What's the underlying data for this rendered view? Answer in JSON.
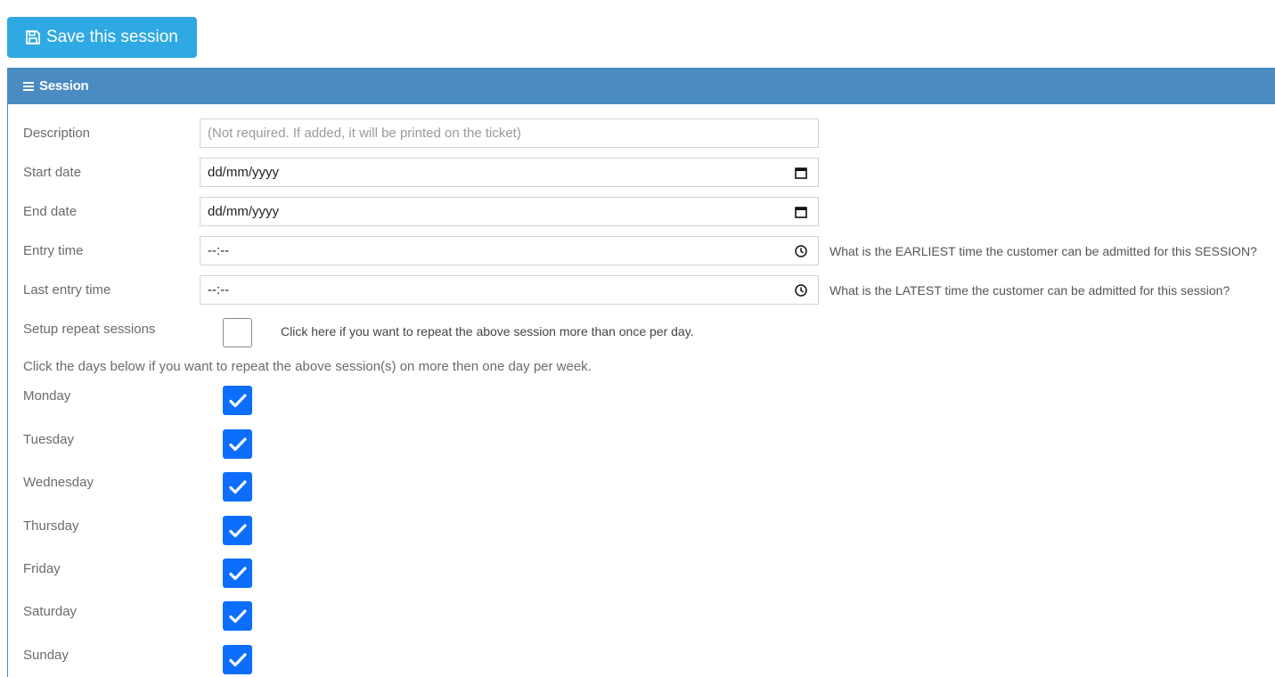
{
  "toolbar": {
    "save_label": "Save this session",
    "save_icon": "floppy-disk-icon",
    "save_color": "#2fa9e3"
  },
  "panel": {
    "title": "Session",
    "title_icon": "hamburger-menu-icon",
    "header_color": "#4a8bc2"
  },
  "form": {
    "description": {
      "label": "Description",
      "placeholder": "(Not required. If added, it will be printed on the ticket)",
      "value": ""
    },
    "start_date": {
      "label": "Start date",
      "value": "dd/mm/yyyy",
      "icon": "calendar-icon"
    },
    "end_date": {
      "label": "End date",
      "value": "dd/mm/yyyy",
      "icon": "calendar-icon"
    },
    "entry_time": {
      "label": "Entry time",
      "value": "--:--",
      "icon": "clock-icon",
      "help": "What is the EARLIEST time the customer can be admitted for this SESSION?"
    },
    "last_entry_time": {
      "label": "Last entry time",
      "value": "--:--",
      "icon": "clock-icon",
      "help": "What is the LATEST time the customer can be admitted for this session?"
    },
    "repeat_sessions": {
      "label": "Setup repeat sessions",
      "checked": false,
      "help": "Click here if you want to repeat the above session more than once per day."
    }
  },
  "days": {
    "intro": "Click the days below if you want to repeat the above session(s) on more then one day per week.",
    "checkbox_color": "#0d6efd",
    "items": [
      {
        "label": "Monday",
        "checked": true
      },
      {
        "label": "Tuesday",
        "checked": true
      },
      {
        "label": "Wednesday",
        "checked": true
      },
      {
        "label": "Thursday",
        "checked": true
      },
      {
        "label": "Friday",
        "checked": true
      },
      {
        "label": "Saturday",
        "checked": true
      },
      {
        "label": "Sunday",
        "checked": true
      }
    ]
  }
}
